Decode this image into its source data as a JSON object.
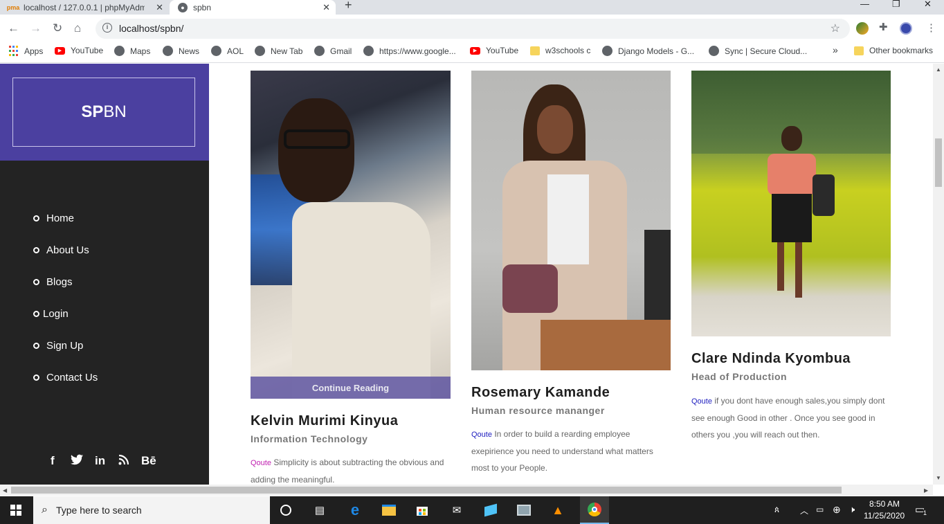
{
  "browser": {
    "tabs": [
      {
        "title": "localhost / 127.0.0.1 | phpMyAdm"
      },
      {
        "title": "spbn"
      }
    ],
    "new_tab_glyph": "+",
    "window_controls": [
      "—",
      "❐",
      "✕"
    ],
    "url": "localhost/spbn/",
    "bookmarks": [
      {
        "label": "Apps",
        "icon": "apps-icon"
      },
      {
        "label": "YouTube",
        "icon": "youtube-icon"
      },
      {
        "label": "Maps",
        "icon": "globe-icon"
      },
      {
        "label": "News",
        "icon": "globe-icon"
      },
      {
        "label": "AOL",
        "icon": "globe-icon"
      },
      {
        "label": "New Tab",
        "icon": "globe-icon"
      },
      {
        "label": "Gmail",
        "icon": "globe-icon"
      },
      {
        "label": "https://www.google...",
        "icon": "globe-icon"
      },
      {
        "label": "YouTube",
        "icon": "youtube-icon"
      },
      {
        "label": "w3schools c",
        "icon": "folder-icon"
      },
      {
        "label": "Django Models - G...",
        "icon": "globe-icon"
      },
      {
        "label": "Sync | Secure Cloud...",
        "icon": "globe-icon"
      }
    ],
    "more_bookmarks": "»",
    "other_bookmarks": "Other bookmarks"
  },
  "site": {
    "brand_bold": "SP",
    "brand_rest": "BN",
    "menu": [
      "Home",
      "About Us",
      "Blogs",
      "Login",
      "Sign Up",
      "Contact Us"
    ],
    "social": [
      "f",
      "𝕥",
      "in",
      "rss",
      "Bē"
    ],
    "accent": "#4b40a0",
    "sidebar_bg": "#232323"
  },
  "cards": [
    {
      "name": "Kelvin Murimi Kinyua",
      "role": "Information Technology",
      "quote_label": "Qoute",
      "quote": "Simplicity is about subtracting the obvious and adding the meaningful.",
      "quote_label_color": "#c020b0",
      "cta": "Continue Reading"
    },
    {
      "name": "Rosemary Kamande",
      "role": "Human resource mananger",
      "quote_label": "Qoute",
      "quote": "In order to build a rearding employee exepirience you need to understand what matters most to your People.",
      "quote_label_color": "#2020c0"
    },
    {
      "name": "Clare Ndinda Kyombua",
      "role": "Head of Production",
      "quote_label": "Qoute",
      "quote": "if you dont have enough sales,you simply dont see enough Good in other . Once you see good in others you ,you will reach out then.",
      "quote_label_color": "#2020c0"
    }
  ],
  "taskbar": {
    "search_placeholder": "Type here to search",
    "time": "8:50 AM",
    "date": "11/25/2020",
    "notification_count": "1"
  }
}
